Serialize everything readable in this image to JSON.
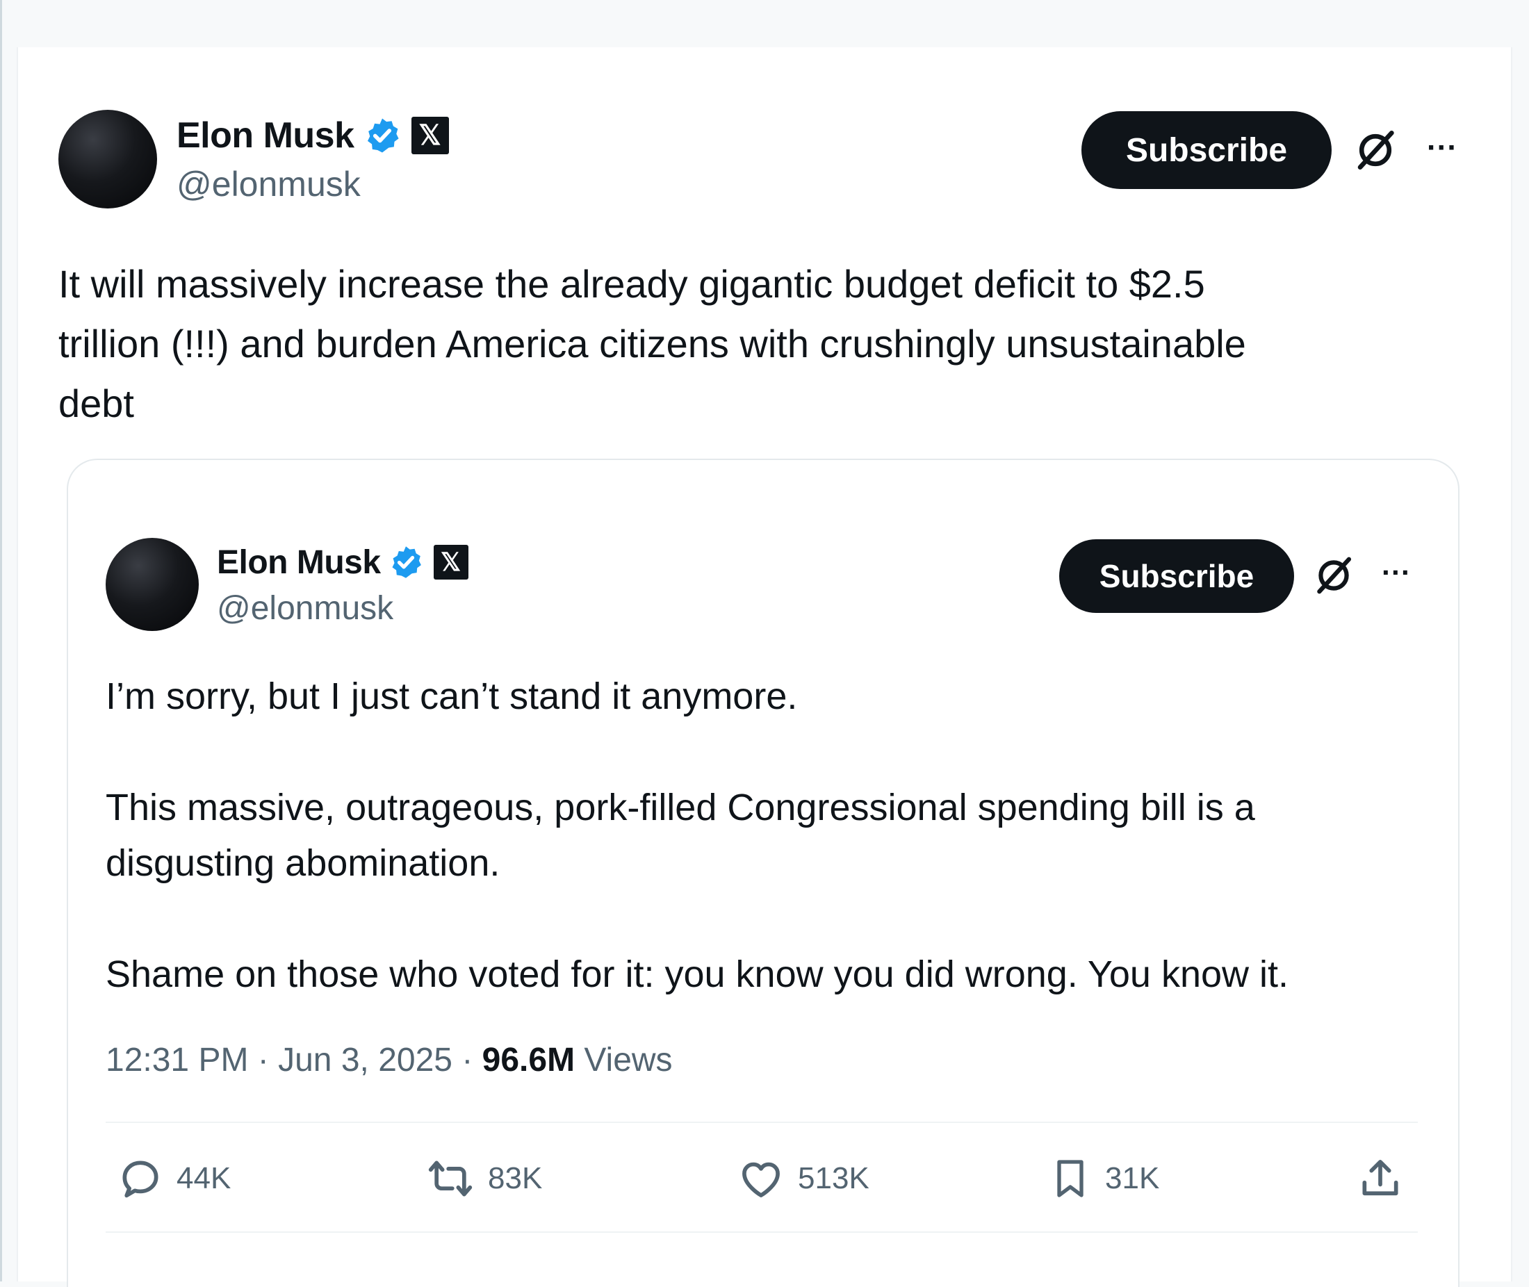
{
  "main_post": {
    "author_name": "Elon Musk",
    "handle": "@elonmusk",
    "subscribe_label": "Subscribe",
    "more_label": "···",
    "text": "It will massively increase the already gigantic budget deficit to $2.5\ntrillion (!!!) and burden America citizens with crushingly unsustainable\ndebt"
  },
  "quoted_post": {
    "author_name": "Elon Musk",
    "handle": "@elonmusk",
    "subscribe_label": "Subscribe",
    "more_label": "···",
    "paragraph_1": "I’m sorry, but I just can’t stand it anymore.",
    "paragraph_2": "This massive, outrageous, pork-filled Congressional spending bill is a\ndisgusting abomination.",
    "paragraph_3": "Shame on those who voted for it: you know you did wrong. You know it.",
    "time": "12:31 PM",
    "separator": " · ",
    "date": "Jun 3, 2025",
    "views_count": "96.6M",
    "views_label": " Views",
    "actions": {
      "replies": "44K",
      "reposts": "83K",
      "likes": "513K",
      "bookmarks": "31K"
    }
  },
  "colors": {
    "text_primary": "#0f1419",
    "text_secondary": "#536471",
    "verified_blue": "#1d9bf0",
    "button_dark": "#0f1419"
  },
  "icons": [
    "verified-icon",
    "x-badge-icon",
    "grok-icon",
    "more-icon",
    "reply-icon",
    "repost-icon",
    "like-icon",
    "bookmark-icon",
    "share-icon"
  ]
}
